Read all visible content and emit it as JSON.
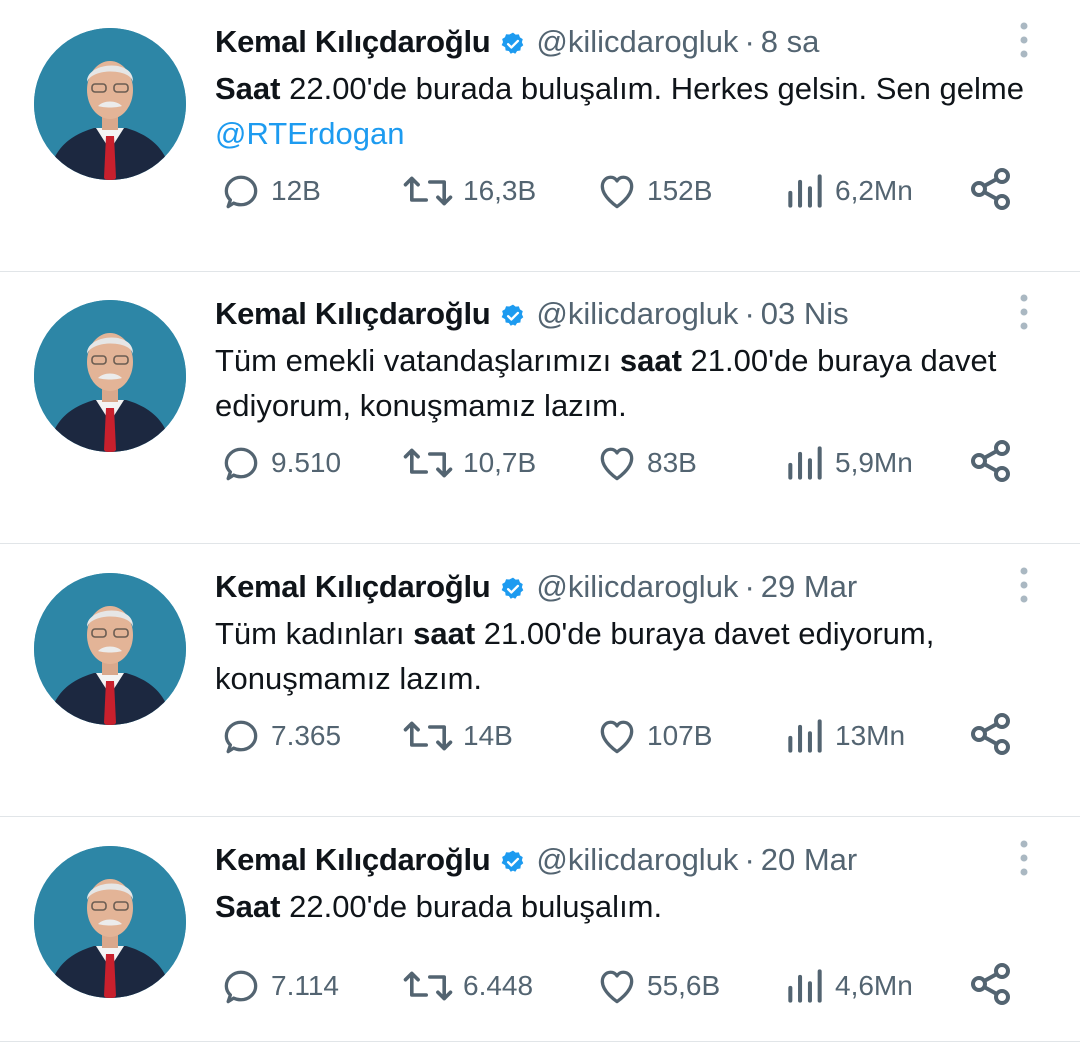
{
  "tweets": [
    {
      "author_name": "Kemal Kılıçdaroğlu",
      "handle": "@kilicdarogluk",
      "separator": "·",
      "time": "8 sa",
      "text_parts": [
        {
          "t": "Saat",
          "bold": true
        },
        {
          "t": " 22.00'de burada buluşalım. Herkes gelsin. Sen gelme "
        },
        {
          "t": "@RTErdogan",
          "link": true
        }
      ],
      "replies": "12B",
      "retweets": "16,3B",
      "likes": "152B",
      "views": "6,2Mn"
    },
    {
      "author_name": "Kemal Kılıçdaroğlu",
      "handle": "@kilicdarogluk",
      "separator": "·",
      "time": "03 Nis",
      "text_parts": [
        {
          "t": "Tüm emekli vatandaşlarımızı "
        },
        {
          "t": "saat",
          "bold": true
        },
        {
          "t": " 21.00'de buraya davet ediyorum, konuşmamız lazım."
        }
      ],
      "replies": "9.510",
      "retweets": "10,7B",
      "likes": "83B",
      "views": "5,9Mn"
    },
    {
      "author_name": "Kemal Kılıçdaroğlu",
      "handle": "@kilicdarogluk",
      "separator": "·",
      "time": "29 Mar",
      "text_parts": [
        {
          "t": "Tüm kadınları "
        },
        {
          "t": "saat",
          "bold": true
        },
        {
          "t": " 21.00'de buraya davet ediyorum, konuşmamız lazım."
        }
      ],
      "replies": "7.365",
      "retweets": "14B",
      "likes": "107B",
      "views": "13Mn"
    },
    {
      "author_name": "Kemal Kılıçdaroğlu",
      "handle": "@kilicdarogluk",
      "separator": "·",
      "time": "20 Mar",
      "text_parts": [
        {
          "t": "Saat",
          "bold": true
        },
        {
          "t": " 22.00'de burada buluşalım."
        }
      ],
      "replies": "7.114",
      "retweets": "6.448",
      "likes": "55,6B",
      "views": "4,6Mn"
    }
  ],
  "icons": {
    "verified": "verified-badge-icon",
    "more": "more-vertical-icon",
    "reply": "reply-icon",
    "retweet": "retweet-icon",
    "like": "heart-icon",
    "views": "views-bar-chart-icon",
    "share": "share-icon"
  },
  "colors": {
    "accent": "#1d9bf0",
    "secondary_text": "#536471",
    "divider": "#e1e5e8",
    "avatar_bg": "#2d86a6"
  }
}
